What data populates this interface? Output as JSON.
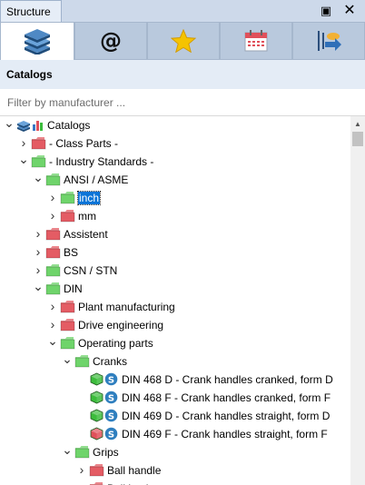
{
  "window": {
    "title": "Structure",
    "maximize_glyph": "▣",
    "close_glyph": "✕"
  },
  "tabs": [
    {
      "name": "catalogs-tab",
      "icon": "books-icon",
      "active": true
    },
    {
      "name": "email-tab",
      "icon": "at-sign-icon",
      "active": false
    },
    {
      "name": "favorites-tab",
      "icon": "star-icon",
      "active": false
    },
    {
      "name": "calendar-tab",
      "icon": "calendar-icon",
      "active": false
    },
    {
      "name": "export-tab",
      "icon": "export-arrow-icon",
      "active": false
    }
  ],
  "header": {
    "title": "Catalogs"
  },
  "filter": {
    "placeholder": "Filter by manufacturer ..."
  },
  "tree": {
    "items": [
      {
        "label": "Catalogs",
        "depth": 0,
        "expanded": true,
        "icon": "catalogs-root-icon"
      },
      {
        "label": "- Class Parts -",
        "depth": 1,
        "expanded": false,
        "icon": "folder-red"
      },
      {
        "label": "- Industry Standards -",
        "depth": 1,
        "expanded": true,
        "icon": "folder-green"
      },
      {
        "label": "ANSI / ASME",
        "depth": 2,
        "expanded": true,
        "icon": "folder-green"
      },
      {
        "label": "inch",
        "depth": 3,
        "expanded": false,
        "icon": "folder-green",
        "selected": true
      },
      {
        "label": "mm",
        "depth": 3,
        "expanded": false,
        "icon": "folder-red"
      },
      {
        "label": "Assistent",
        "depth": 2,
        "expanded": false,
        "icon": "folder-red"
      },
      {
        "label": "BS",
        "depth": 2,
        "expanded": false,
        "icon": "folder-red"
      },
      {
        "label": "CSN / STN",
        "depth": 2,
        "expanded": false,
        "icon": "folder-green"
      },
      {
        "label": "DIN",
        "depth": 2,
        "expanded": true,
        "icon": "folder-green"
      },
      {
        "label": "Plant manufacturing",
        "depth": 3,
        "expanded": false,
        "icon": "folder-red"
      },
      {
        "label": "Drive engineering",
        "depth": 3,
        "expanded": false,
        "icon": "folder-red"
      },
      {
        "label": "Operating parts",
        "depth": 3,
        "expanded": true,
        "icon": "folder-green"
      },
      {
        "label": "Cranks",
        "depth": 4,
        "expanded": true,
        "icon": "folder-green"
      },
      {
        "label": "DIN 468 D - Crank handles cranked, form D",
        "depth": 5,
        "leaf": true,
        "icon": "part-green"
      },
      {
        "label": "DIN 468 F - Crank handles cranked, form F",
        "depth": 5,
        "leaf": true,
        "icon": "part-green"
      },
      {
        "label": "DIN 469 D - Crank handles straight, form D",
        "depth": 5,
        "leaf": true,
        "icon": "part-green"
      },
      {
        "label": "DIN 469 F - Crank handles straight, form F",
        "depth": 5,
        "leaf": true,
        "icon": "part-red"
      },
      {
        "label": "Grips",
        "depth": 4,
        "expanded": true,
        "icon": "folder-green"
      },
      {
        "label": "Ball handle",
        "depth": 5,
        "expanded": false,
        "icon": "folder-red"
      },
      {
        "label": "Ball knobs",
        "depth": 5,
        "expanded": false,
        "icon": "folder-red"
      }
    ]
  },
  "colors": {
    "folder_green": "#6fd46b",
    "folder_red": "#e45c64",
    "cube_green": "#3cbc3c",
    "cube_red": "#e0505a",
    "s_badge": "#2f7fbf",
    "selection": "#0a74d7",
    "tab_bar": "#cdd9ea",
    "header_bg": "#e4ecf6"
  }
}
